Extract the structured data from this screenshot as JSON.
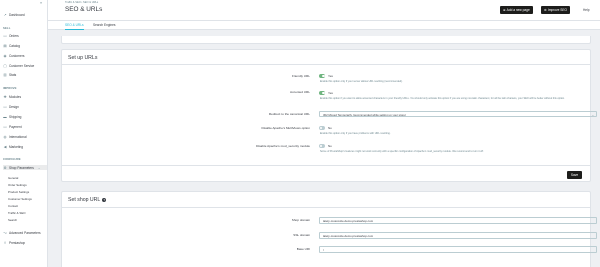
{
  "sidebar": {
    "dashboard": "Dashboard",
    "sell_section": "SELL",
    "sell_items": [
      "Orders",
      "Catalog",
      "Customers",
      "Customer Service",
      "Stats"
    ],
    "improve_section": "IMPROVE",
    "improve_items": [
      "Modules",
      "Design",
      "Shipping",
      "Payment",
      "International",
      "Marketing"
    ],
    "configure_section": "CONFIGURE",
    "shop_parameters": "Shop Parameters",
    "shop_sub_items": [
      "General",
      "Order Settings",
      "Product Settings",
      "Customer Settings",
      "Contact",
      "Traffic & SEO",
      "Search"
    ],
    "advanced": "Advanced Parameters",
    "prestashop": "Prestashop"
  },
  "header": {
    "breadcrumb": "Traffic & SEO  •  SEO & URLs",
    "title": "SEO & URLs",
    "add_page": "Add a new page",
    "improve_seo": "Improve SEO",
    "help": "Help"
  },
  "tabs": [
    "SEO & URLs",
    "Search Engines"
  ],
  "setup": {
    "title": "Set up URLs",
    "friendly_label": "Friendly URL",
    "friendly_value": "Yes",
    "friendly_help": "Enable this option only if your server allows URL rewriting (recommended).",
    "accented_label": "Accented URL",
    "accented_value": "Yes",
    "accented_help": "Enable this option if you want to allow accented characters in your friendly URLs. You should only activate this option if you are using non-latin characters; for all the latin charsets, your SEO will be better without this option.",
    "redirect_label": "Redirect to the canonical URL",
    "redirect_value": "302 Moved Temporarily (recommended while setting up your store)",
    "pathinfo_label": "Disable Apache's MultiViews option",
    "pathinfo_value": "No",
    "pathinfo_help": "Enable this option only if you have problems with URL rewriting.",
    "security_label": "Disable Apache's mod_security module",
    "security_value": "No",
    "security_help": "Some of PrestaShop's features might not work correctly with a specific configuration of Apache's mod_security module. We recommend to turn it off.",
    "save": "Save"
  },
  "shop_url": {
    "title": "Set shop URL",
    "domain_label": "Shop domain",
    "domain_value": "lately-muscovite.demo.prestashop.com",
    "ssl_label": "SSL domain",
    "ssl_value": "lately-muscovite.demo.prestashop.com",
    "base_label": "Base URI",
    "base_value": "/"
  }
}
